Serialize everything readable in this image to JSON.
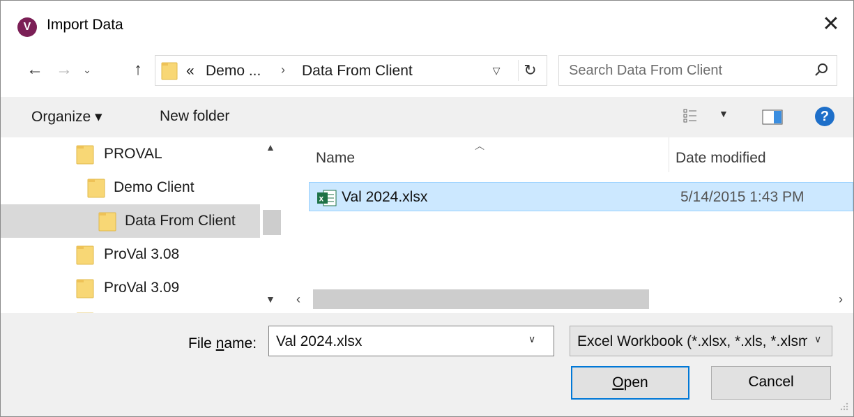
{
  "window": {
    "title": "Import Data",
    "app_icon_letter": "V",
    "close_glyph": "✕"
  },
  "address_bar": {
    "overflow": "«",
    "crumbs": [
      "Demo ...",
      "Data From Client"
    ],
    "separator": "›"
  },
  "search": {
    "placeholder": "Search Data From Client",
    "value": ""
  },
  "command_bar": {
    "organize_label": "Organize ▾",
    "new_folder_label": "New folder",
    "view_dd": "▼",
    "help": "?"
  },
  "tree": {
    "items": [
      {
        "label": "PROVAL"
      },
      {
        "label": "Demo Client"
      },
      {
        "label": "Data From Client",
        "selected": true
      },
      {
        "label": "ProVal 3.08"
      },
      {
        "label": "ProVal 3.09"
      }
    ]
  },
  "file_list": {
    "columns": {
      "name": "Name",
      "date_modified": "Date modified"
    },
    "rows": [
      {
        "name": "Val 2024.xlsx",
        "date_modified": "5/14/2015 1:43 PM",
        "selected": true
      }
    ]
  },
  "bottom": {
    "file_name_label_pre": "File ",
    "file_name_label_u": "n",
    "file_name_label_post": "ame:",
    "file_name_value": "Val 2024.xlsx",
    "file_type": "Excel Workbook (*.xlsx, *.xls, *.xlsm)",
    "open_u": "O",
    "open_rest": "pen",
    "cancel_label": "Cancel"
  },
  "colors": {
    "accent": "#0078d7",
    "selection": "#cce8ff",
    "app_icon": "#7b1f56",
    "help": "#1e6fc9"
  }
}
